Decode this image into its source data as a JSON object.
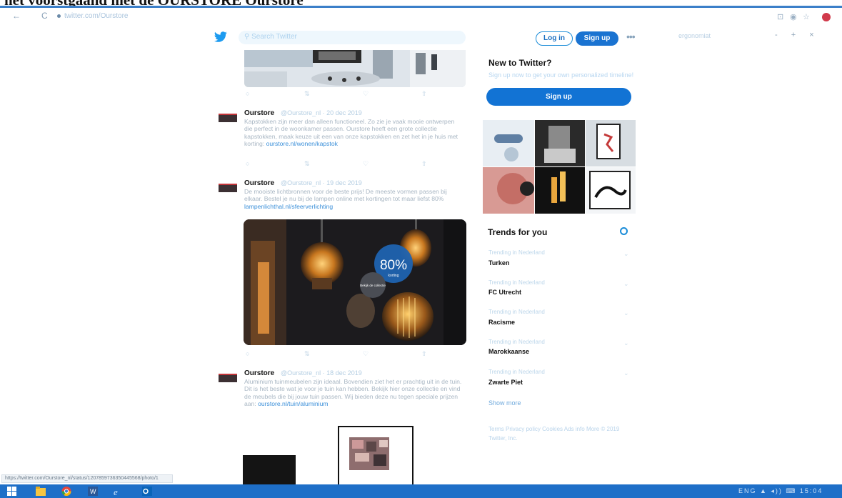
{
  "caption": {
    "text": "het voorstgaand met de OURSTORE Ourstore"
  },
  "browser": {
    "back": "←",
    "reload": "C",
    "address": "twitter.com/Ourstore",
    "extensions": [
      "⊡",
      "◉",
      "☆"
    ]
  },
  "twitter_header": {
    "search_placeholder": "Search Twitter",
    "login_label": "Log in",
    "signup_label": "Sign up",
    "more_label": "•••",
    "right_field": "ergonomiat",
    "right_controls": "- + ×"
  },
  "tweets": [
    {
      "name": "Ourstore",
      "meta": "@Ourstore_nl · 20 dec 2019",
      "body": "Kapstokken zijn meer dan alleen functioneel. Zo zie je vaak mooie ontwerpen die perfect in de woonkamer passen. Ourstore heeft een grote collectie kapstokken, maak keuze uit een van onze kapstokken en zet het in je huis met korting:",
      "link": "ourstore.nl/wonen/kapstok"
    },
    {
      "name": "Ourstore",
      "meta": "@Ourstore_nl · 19 dec 2019",
      "body": "De mooiste lichtbronnen voor de beste prijs! De meeste vormen passen bij elkaar. Bestel je nu bij de lampen online met kortingen tot maar liefst 80%",
      "link": "lampenlichthal.nl/sfeerverlichting"
    },
    {
      "name": "Ourstore",
      "meta": "@Ourstore_nl · 18 dec 2019",
      "body": "Aluminium tuinmeubelen zijn ideaal. Bovendien ziet het er prachtig uit in de tuin. Dit is het beste wat je voor je tuin kan hebben. Bekijk hier onze collectie en vind de meubels die bij jouw tuin passen. Wij bieden deze nu tegen speciale prijzen aan:",
      "link": "ourstore.nl/tuin/aluminium"
    }
  ],
  "promo": {
    "percent": "80%",
    "small": "korting",
    "badge": "Bekijk de collectie"
  },
  "actions": {
    "reply": "○",
    "retweet": "⇅",
    "like": "♡",
    "share": "⇧"
  },
  "sidebar": {
    "new_title": "New to Twitter?",
    "new_sub": "Sign up now to get your own personalized timeline!",
    "signup_label": "Sign up",
    "trends_title": "Trends for you",
    "trends": [
      {
        "context": "Trending in Nederland",
        "name": "Turken"
      },
      {
        "context": "Trending in Nederland",
        "name": "FC Utrecht"
      },
      {
        "context": "Trending in Nederland",
        "name": "Racisme"
      },
      {
        "context": "Trending in Nederland",
        "name": "Marokkaanse"
      },
      {
        "context": "Trending in Nederland",
        "name": "Zwarte Piet"
      }
    ],
    "show_more": "Show more",
    "footer": "Terms Privacy policy Cookies Ads info More © 2019 Twitter, Inc."
  },
  "status_url": "https://twitter.com/Ourstore_nl/status/1207859736350445568/photo/1",
  "tray_text": "ENG ▲ ◂)) ⌨ 15:04"
}
